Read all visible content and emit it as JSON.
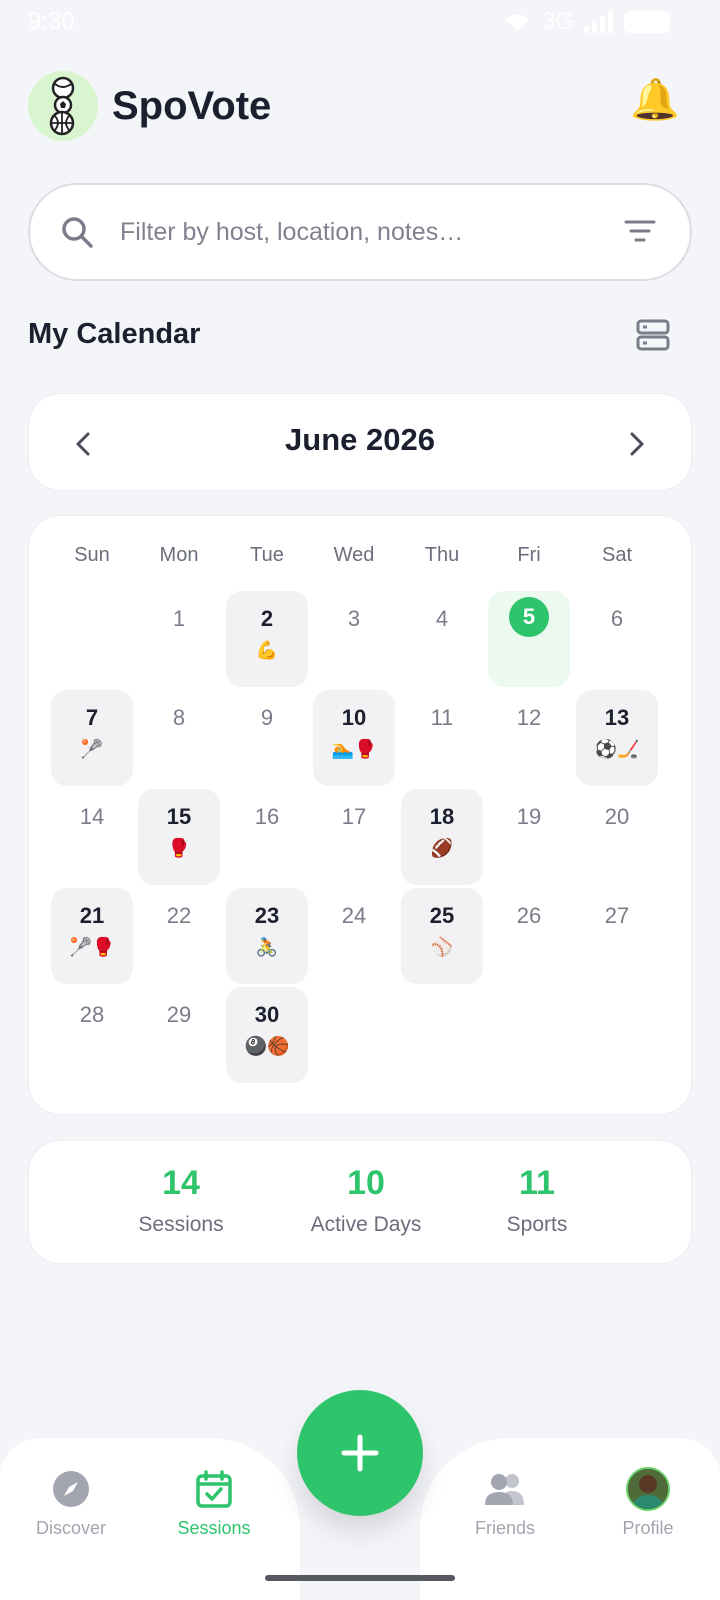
{
  "status_bar": {
    "time": "9:30",
    "network": "3G"
  },
  "header": {
    "title": "SpoVote",
    "logo_icon": "sports-balls-logo",
    "bell_icon": "🔔"
  },
  "search": {
    "placeholder": "Filter by host, location, notes…"
  },
  "calendar_section": {
    "title": "My Calendar"
  },
  "month_nav": {
    "label": "June 2026"
  },
  "calendar": {
    "weekdays": [
      "Sun",
      "Mon",
      "Tue",
      "Wed",
      "Thu",
      "Fri",
      "Sat"
    ],
    "days": [
      {
        "num": "1",
        "emoji": ""
      },
      {
        "num": "2",
        "emoji": "💪"
      },
      {
        "num": "3",
        "emoji": ""
      },
      {
        "num": "4",
        "emoji": ""
      },
      {
        "num": "5",
        "emoji": "",
        "today": true
      },
      {
        "num": "6",
        "emoji": ""
      },
      {
        "num": "7",
        "emoji": "🥍"
      },
      {
        "num": "8",
        "emoji": ""
      },
      {
        "num": "9",
        "emoji": ""
      },
      {
        "num": "10",
        "emoji": "🏊🥊"
      },
      {
        "num": "11",
        "emoji": ""
      },
      {
        "num": "12",
        "emoji": ""
      },
      {
        "num": "13",
        "emoji": "⚽🏒"
      },
      {
        "num": "14",
        "emoji": ""
      },
      {
        "num": "15",
        "emoji": "🥊"
      },
      {
        "num": "16",
        "emoji": ""
      },
      {
        "num": "17",
        "emoji": ""
      },
      {
        "num": "18",
        "emoji": "🏈"
      },
      {
        "num": "19",
        "emoji": ""
      },
      {
        "num": "20",
        "emoji": ""
      },
      {
        "num": "21",
        "emoji": "🥍🥊"
      },
      {
        "num": "22",
        "emoji": ""
      },
      {
        "num": "23",
        "emoji": "🚴"
      },
      {
        "num": "24",
        "emoji": ""
      },
      {
        "num": "25",
        "emoji": "⚾"
      },
      {
        "num": "26",
        "emoji": ""
      },
      {
        "num": "27",
        "emoji": ""
      },
      {
        "num": "28",
        "emoji": ""
      },
      {
        "num": "29",
        "emoji": ""
      },
      {
        "num": "30",
        "emoji": "🎱🏀"
      }
    ]
  },
  "stats": [
    {
      "value": "14",
      "label": "Sessions"
    },
    {
      "value": "10",
      "label": "Active Days"
    },
    {
      "value": "11",
      "label": "Sports"
    }
  ],
  "bottom_nav": {
    "items": [
      {
        "label": "Discover",
        "icon": "compass-icon"
      },
      {
        "label": "Sessions",
        "icon": "calendar-check-icon",
        "active": true
      },
      {
        "label": "Friends",
        "icon": "people-icon"
      },
      {
        "label": "Profile",
        "icon": "avatar"
      }
    ],
    "fab_icon": "plus-icon"
  },
  "colors": {
    "accent": "#2ec46b",
    "background": "#f4f5f9"
  }
}
